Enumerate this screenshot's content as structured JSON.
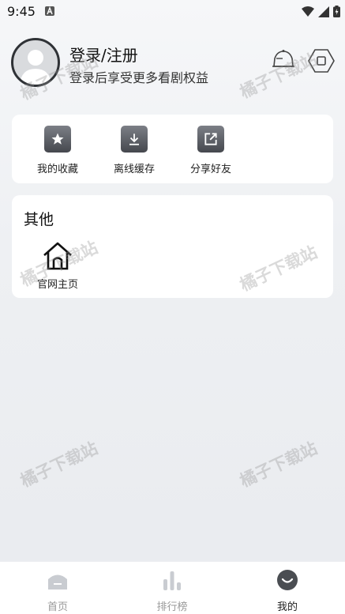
{
  "status": {
    "time": "9:45"
  },
  "profile": {
    "title": "登录/注册",
    "subtitle": "登录后享受更多看剧权益"
  },
  "quick": [
    {
      "label": "我的收藏"
    },
    {
      "label": "离线缓存"
    },
    {
      "label": "分享好友"
    }
  ],
  "other": {
    "title": "其他",
    "home_label": "官网主页"
  },
  "watermark": "橘子下载站",
  "nav": [
    {
      "label": "首页"
    },
    {
      "label": "排行榜"
    },
    {
      "label": "我的"
    }
  ]
}
